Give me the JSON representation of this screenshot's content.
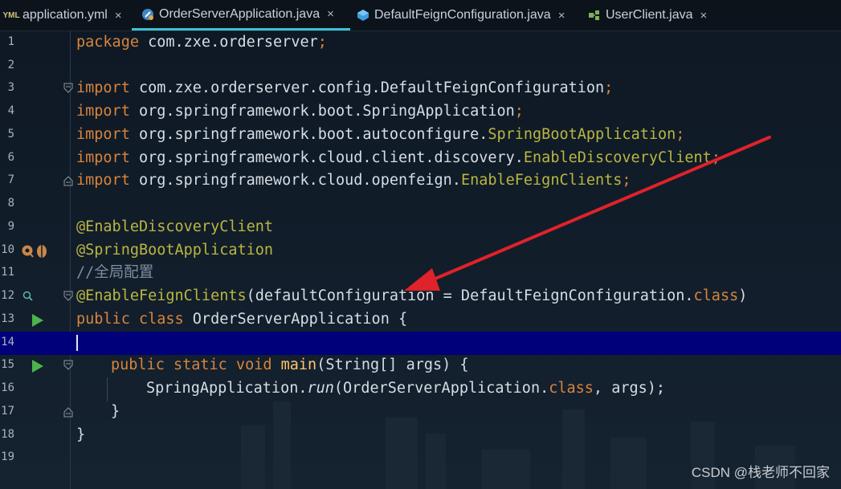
{
  "tabs": [
    {
      "label": "application.yml",
      "icon": "yaml-file-icon",
      "icon_text": "YML",
      "active": false
    },
    {
      "label": "OrderServerApplication.java",
      "icon": "java-class-icon",
      "active": true
    },
    {
      "label": "DefaultFeignConfiguration.java",
      "icon": "java-interface-icon",
      "active": false
    },
    {
      "label": "UserClient.java",
      "icon": "java-class-icon",
      "active": false
    }
  ],
  "close_glyph": "×",
  "line_numbers": [
    "1",
    "2",
    "3",
    "4",
    "5",
    "6",
    "7",
    "8",
    "9",
    "10",
    "11",
    "12",
    "13",
    "14",
    "15",
    "16",
    "17",
    "18",
    "19"
  ],
  "code": {
    "l1": {
      "kw": "package",
      "rest": " com.zxe.orderserver",
      "semi": ";"
    },
    "l3": {
      "kw": "import",
      "rest": " com.zxe.orderserver.config.DefaultFeignConfiguration",
      "semi": ";"
    },
    "l4": {
      "kw": "import",
      "rest": " org.springframework.boot.SpringApplication",
      "semi": ";"
    },
    "l5": {
      "kw": "import",
      "rest": " org.springframework.boot.autoconfigure.",
      "ann": "SpringBootApplication",
      "semi": ";"
    },
    "l6": {
      "kw": "import",
      "rest": " org.springframework.cloud.client.discovery.",
      "ann": "EnableDiscoveryClient",
      "semi": ";"
    },
    "l7": {
      "kw": "import",
      "rest": " org.springframework.cloud.openfeign.",
      "ann": "EnableFeignClients",
      "semi": ";"
    },
    "l9": {
      "ann": "@EnableDiscoveryClient"
    },
    "l10": {
      "ann": "@SpringBootApplication"
    },
    "l11": {
      "cmt": "//全局配置"
    },
    "l12": {
      "ann": "@EnableFeignClients",
      "a": "(defaultConfiguration = DefaultFeignConfiguration.",
      "cls": "class",
      "b": ")"
    },
    "l13": {
      "kw": "public class",
      "rest": " OrderServerApplication {"
    },
    "l15": {
      "kw": "public static void",
      "fn": " main",
      "rest": "(String[] args) {"
    },
    "l16": {
      "a": "SpringApplication.",
      "it": "run",
      "b": "(OrderServerApplication.",
      "cls": "class",
      "c": ", args);"
    },
    "l17": {
      "text": "}"
    },
    "l18": {
      "text": "}"
    }
  },
  "watermark": "CSDN @栈老师不回家",
  "colors": {
    "keyword": "#d8843c",
    "annotation": "#b9b640",
    "comment": "#7d8d9e",
    "current_line": "#00007a",
    "active_tab_underline": "#3fc1d6",
    "arrow": "#e0222a"
  }
}
